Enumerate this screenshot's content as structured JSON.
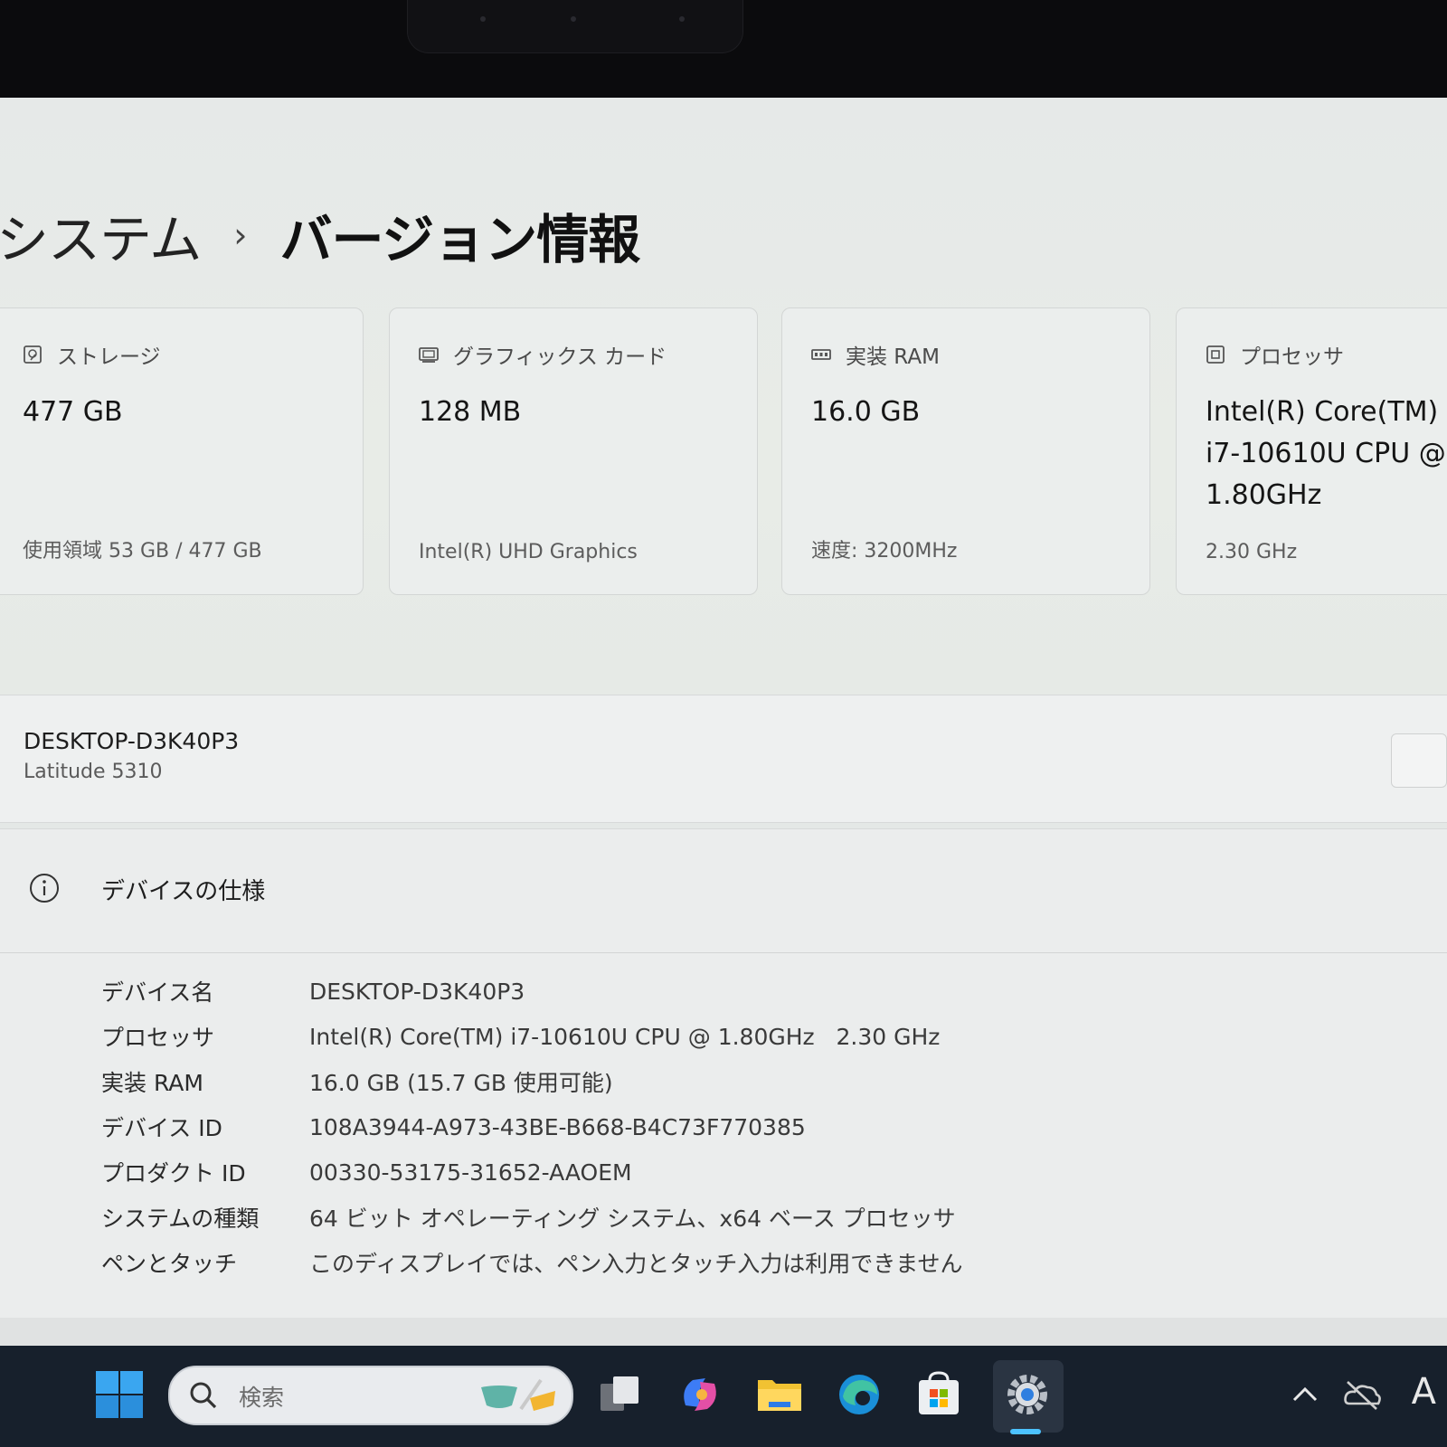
{
  "breadcrumb": {
    "parent": "システム",
    "separator": "›",
    "current": "バージョン情報"
  },
  "cards": [
    {
      "title": "ストレージ",
      "icon": "storage-icon",
      "value": "477 GB",
      "sub": "使用領域 53 GB / 477 GB"
    },
    {
      "title": "グラフィックス カード",
      "icon": "graphics-card-icon",
      "value": "128 MB",
      "sub": "Intel(R) UHD Graphics"
    },
    {
      "title": "実装 RAM",
      "icon": "ram-icon",
      "value": "16.0 GB",
      "sub": "速度: 3200MHz"
    },
    {
      "title": "プロセッサ",
      "icon": "processor-icon",
      "value_lines": [
        "Intel(R) Core(TM)",
        "i7-10610U CPU @",
        "1.80GHz"
      ],
      "sub": "2.30 GHz"
    }
  ],
  "pc": {
    "name": "DESKTOP-D3K40P3",
    "model": "Latitude 5310"
  },
  "specs": {
    "title": "デバイスの仕様",
    "rows": [
      {
        "key": "デバイス名",
        "value": "DESKTOP-D3K40P3"
      },
      {
        "key": "プロセッサ",
        "value": "Intel(R) Core(TM) i7-10610U CPU @ 1.80GHz   2.30 GHz"
      },
      {
        "key": "実装 RAM",
        "value": "16.0 GB (15.7 GB 使用可能)"
      },
      {
        "key": "デバイス ID",
        "value": "108A3944-A973-43BE-B668-B4C73F770385"
      },
      {
        "key": "プロダクト ID",
        "value": "00330-53175-31652-AAOEM"
      },
      {
        "key": "システムの種類",
        "value": "64 ビット オペレーティング システム、x64 ベース プロセッサ"
      },
      {
        "key": "ペンとタッチ",
        "value": "このディスプレイでは、ペン入力とタッチ入力は利用できません"
      }
    ]
  },
  "taskbar": {
    "search_placeholder": "検索",
    "apps": [
      "start-icon",
      "task-view-icon",
      "copilot-icon",
      "file-explorer-icon",
      "edge-icon",
      "store-icon",
      "settings-icon"
    ],
    "tray_input_indicator": "A"
  },
  "colors": {
    "accent": "#0067c0",
    "taskbar": "#17202c",
    "indicator": "#4cc2ff"
  }
}
